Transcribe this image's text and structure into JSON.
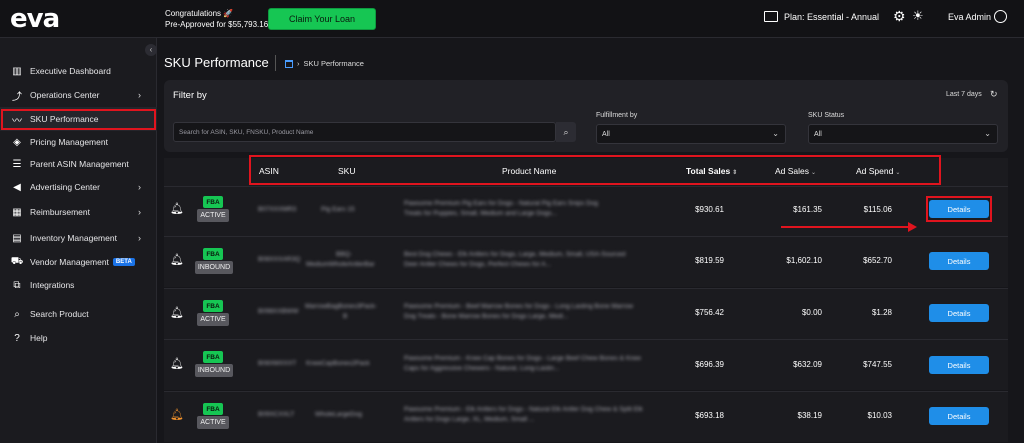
{
  "topbar": {
    "logo": "eva",
    "congrats_line1": "Congratulations",
    "congrats_line2": "Pre-Approved for $55,793.16",
    "claim_button": "Claim Your Loan",
    "plan": "Plan: Essential - Annual",
    "user_name": "Eva Admin"
  },
  "sidebar": {
    "items": [
      {
        "label": "Executive Dashboard",
        "icon": "bar-chart-icon"
      },
      {
        "label": "Operations Center",
        "icon": "route-icon",
        "chevron": true
      },
      {
        "label": "SKU Performance",
        "icon": "trend-icon"
      },
      {
        "label": "Pricing Management",
        "icon": "tag-icon"
      },
      {
        "label": "Parent ASIN Management",
        "icon": "list-icon"
      },
      {
        "label": "Advertising Center",
        "icon": "megaphone-icon",
        "chevron": true
      },
      {
        "label": "Reimbursement",
        "icon": "calendar-icon",
        "chevron": true
      },
      {
        "label": "Inventory Management",
        "icon": "box-icon",
        "chevron": true
      },
      {
        "label": "Vendor Management",
        "icon": "truck-icon",
        "badge": "BETA"
      },
      {
        "label": "Integrations",
        "icon": "integration-icon"
      },
      {
        "label": "Search Product",
        "icon": "search-icon"
      },
      {
        "label": "Help",
        "icon": "help-icon"
      }
    ]
  },
  "page": {
    "title": "SKU Performance",
    "breadcrumb": "SKU Performance"
  },
  "filter": {
    "title": "Filter by",
    "range": "Last 7 days",
    "search_placeholder": "Search for ASIN, SKU, FNSKU, Product Name",
    "fulfillment_label": "Fulfillment by",
    "fulfillment_value": "All",
    "status_label": "SKU Status",
    "status_value": "All"
  },
  "table": {
    "headers": {
      "asin": "ASIN",
      "sku": "SKU",
      "product": "Product Name",
      "total_sales": "Total Sales",
      "ad_sales": "Ad Sales",
      "ad_spend": "Ad Spend"
    },
    "details_label": "Details",
    "rows": [
      {
        "fba": "FBA",
        "status": "ACTIVE",
        "asin": "B07XXXMR3",
        "sku": "Pig Ears 15",
        "product_line1": "Pawsome Premium Pig Ears for Dogs - Natural Pig Ears Snips Dog",
        "product_line2": "Treats for Puppies, Small, Medium and Large Dogs...",
        "total_sales": "$930.61",
        "ad_sales": "$161.35",
        "ad_spend": "$115.06",
        "bell": "white"
      },
      {
        "fba": "FBA",
        "status": "INBOUND",
        "asin": "B08XXXAR3Q",
        "sku": "BBQ-",
        "sku2": "MediumWholeAntlerBar",
        "product_line1": "Best Dog Chews - Elk Antlers for Dogs, Large, Medium, Small, USA-Sourced",
        "product_line2": "Deer Antler Chews for Dogs, Perfect Chews for A...",
        "total_sales": "$819.59",
        "ad_sales": "$1,602.10",
        "ad_spend": "$652.70",
        "bell": "white"
      },
      {
        "fba": "FBA",
        "status": "ACTIVE",
        "asin": "B098XXBWW",
        "sku": "MarrowBagBones3Pack-",
        "sku2": "B",
        "product_line1": "Pawsome Premium - Beef Marrow Bones for Dogs - Long Lasting Bone Marrow",
        "product_line2": "Dog Treats - Bone Marrow Bones for Dogs Large, Medi...",
        "total_sales": "$756.42",
        "ad_sales": "$0.00",
        "ad_spend": "$1.28",
        "bell": "white"
      },
      {
        "fba": "FBA",
        "status": "INBOUND",
        "asin": "B08XMXXXT",
        "sku": "KneeCapBones2Pack",
        "product_line1": "Pawsome Premium - Knee Cap Bones for Dogs - Large Beef Chew Bones & Knee",
        "product_line2": "Caps for Aggressive Chewers - Natural, Long-Lastin...",
        "total_sales": "$696.39",
        "ad_sales": "$632.09",
        "ad_spend": "$747.55",
        "bell": "white"
      },
      {
        "fba": "FBA",
        "status": "ACTIVE",
        "asin": "B09XCXXLT",
        "sku": "WholeLargeDog",
        "product_line1": "Pawsome Premium - Elk Antlers for Dogs - Natural Elk Antler Dog Chew & Split Elk",
        "product_line2": "Antlers for Dogs Large, XL, Medium, Small ...",
        "total_sales": "$693.18",
        "ad_sales": "$38.19",
        "ad_spend": "$10.03",
        "bell": "orange"
      }
    ]
  },
  "colors": {
    "accent_green": "#16c653",
    "accent_blue": "#1f8ee8",
    "annotation_red": "#e0141e"
  }
}
